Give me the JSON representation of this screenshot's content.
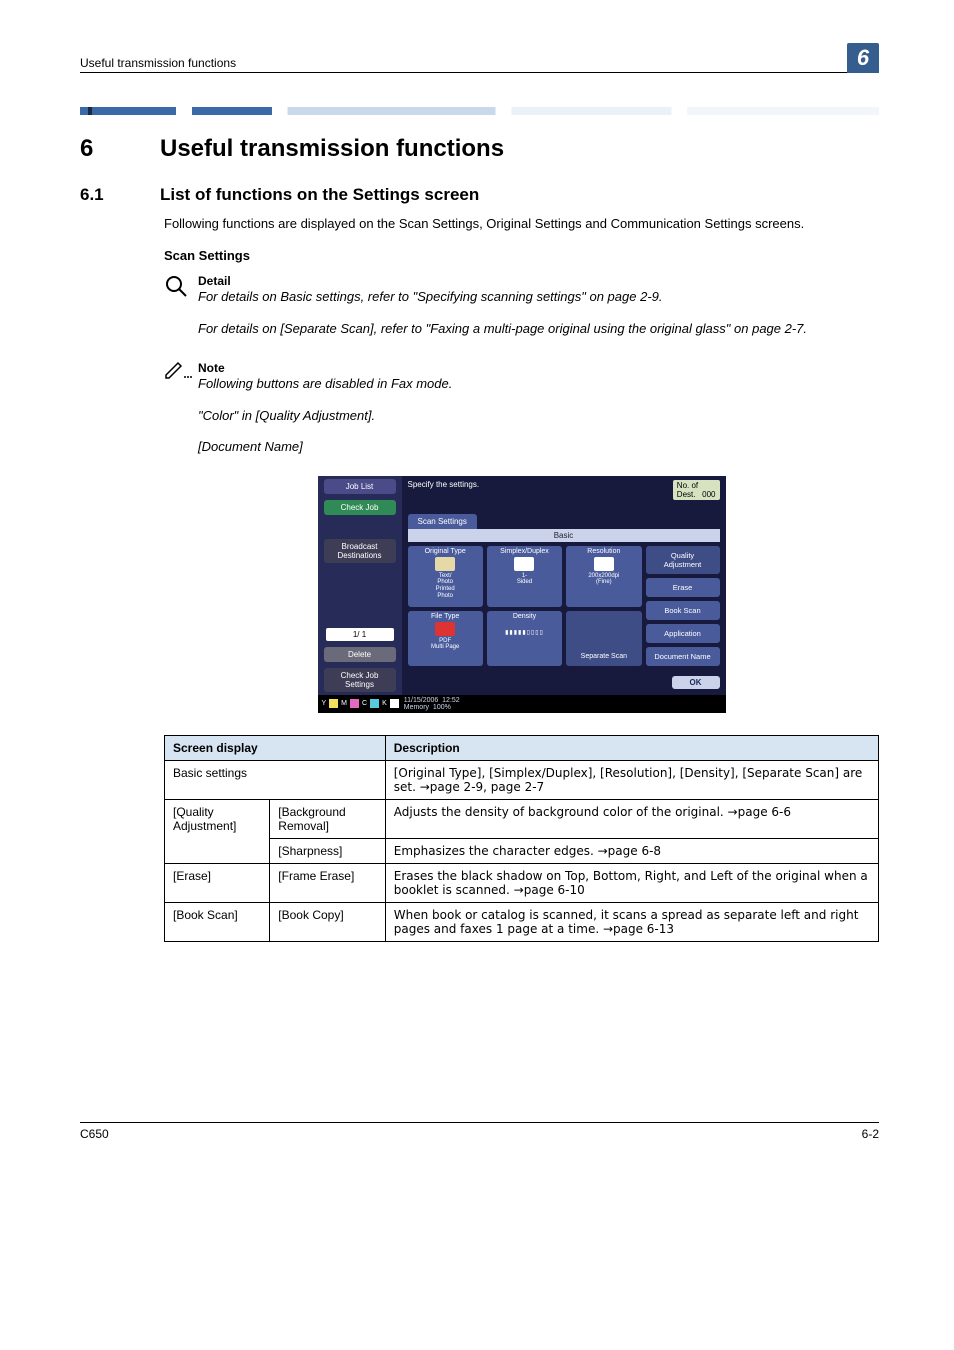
{
  "header": {
    "running_title": "Useful transmission functions",
    "chapter_num_badge": "6"
  },
  "chapter": {
    "number": "6",
    "title": "Useful transmission functions"
  },
  "section": {
    "number": "6.1",
    "title": "List of functions on the Settings screen"
  },
  "intro_text": "Following functions are displayed on the Scan Settings, Original Settings and Communication Settings screens.",
  "scan_heading": "Scan Settings",
  "detail_block": {
    "title": "Detail",
    "line1": "For details on Basic settings, refer to \"Specifying scanning settings\" on page 2-9.",
    "line2": "For details on [Separate Scan], refer to \"Faxing a multi-page original using the original glass\" on page 2-7."
  },
  "note_block": {
    "title": "Note",
    "line1": "Following buttons are disabled in Fax mode.",
    "line2": "\"Color\" in [Quality Adjustment].",
    "line3": "[Document Name]"
  },
  "panel": {
    "job_list": "Job List",
    "check_job": "Check Job",
    "broadcast": "Broadcast\nDestinations",
    "page_indicator": "1/  1",
    "delete": "Delete",
    "check_settings": "Check Job\nSettings",
    "specify": "Specify the settings.",
    "nod_label": "No. of\nDest.",
    "nod_value": "000",
    "scan_settings": "Scan Settings",
    "basic": "Basic",
    "cells": {
      "original_type": "Original Type",
      "original_type_sub": "Text/\nPhoto\nPrinted\nPhoto",
      "simplex": "Simplex/Duplex",
      "simplex_sub": "1-\nSided",
      "resolution": "Resolution",
      "resolution_sub": "200x200dpi\n(Fine)",
      "file_type": "File Type",
      "file_type_sub": "PDF\nMulti Page",
      "density": "Density",
      "separate": "Separate Scan"
    },
    "side": {
      "quality": "Quality\nAdjustment",
      "erase": "Erase",
      "book": "Book Scan",
      "application": "Application",
      "docname": "Document Name"
    },
    "ok": "OK",
    "footer_date": "11/15/2006",
    "footer_time": "12:52",
    "footer_mem_label": "Memory",
    "footer_mem_val": "100%"
  },
  "table": {
    "head_col1": "Screen display",
    "head_col2": "Description",
    "rows": [
      {
        "c1": "Basic settings",
        "c1b": "",
        "c2": "[Original Type], [Simplex/Duplex], [Resolution], [Density], [Separate Scan] are set. →page 2-9, page 2-7",
        "span": true
      },
      {
        "c1": "[Quality Adjustment]",
        "c1b": "[Background Removal]",
        "c2": "Adjusts the density of background color of the original. →page 6-6",
        "rowspan": 2
      },
      {
        "c1": "",
        "c1b": "[Sharpness]",
        "c2": "Emphasizes the character edges. →page 6-8"
      },
      {
        "c1": "[Erase]",
        "c1b": "[Frame Erase]",
        "c2": "Erases the black shadow on Top, Bottom, Right, and Left of the original when a booklet is scanned. →page 6-10"
      },
      {
        "c1": "[Book Scan]",
        "c1b": "[Book Copy]",
        "c2": "When book or catalog is scanned, it scans a spread as separate left and right pages and faxes 1 page at a time. →page 6-13"
      }
    ]
  },
  "footer": {
    "left": "C650",
    "right": "6-2"
  }
}
